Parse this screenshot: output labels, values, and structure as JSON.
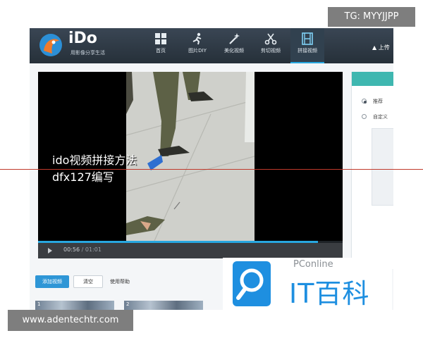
{
  "app": {
    "name": "iDo",
    "slogan": "用影像分享生活"
  },
  "nav": [
    {
      "label": "首页",
      "icon": "grid-icon",
      "active": false
    },
    {
      "label": "图片DIY",
      "icon": "figure-icon",
      "active": false
    },
    {
      "label": "美化视频",
      "icon": "magic-wand-icon",
      "active": false
    },
    {
      "label": "剪切视频",
      "icon": "scissors-icon",
      "active": false
    },
    {
      "label": "拼接视频",
      "icon": "film-icon",
      "active": true
    }
  ],
  "header_right": {
    "upload_label": "上传"
  },
  "video": {
    "overlay_line1": "ido视频拼接方法",
    "overlay_line2": "dfx127编写",
    "time_current": "00:56",
    "time_total": "01:01",
    "progress": 0.92
  },
  "right_panel": {
    "options": [
      {
        "label": "推荐",
        "selected": true
      },
      {
        "label": "自定义",
        "selected": false
      }
    ]
  },
  "toolbar": {
    "add_label": "添加视频",
    "clear_label": "清空",
    "help_label": "使用帮助"
  },
  "thumbnails": [
    {
      "index": "1"
    },
    {
      "index": "2"
    }
  ],
  "watermark": {
    "brand": "PConline",
    "text": "IT百科"
  },
  "corner_tag": "TG: MYYJJPP",
  "corner_url": "www.adentechtr.com",
  "colors": {
    "accent": "#27a7df",
    "header": "#263039",
    "guide_line": "#c0392b"
  }
}
